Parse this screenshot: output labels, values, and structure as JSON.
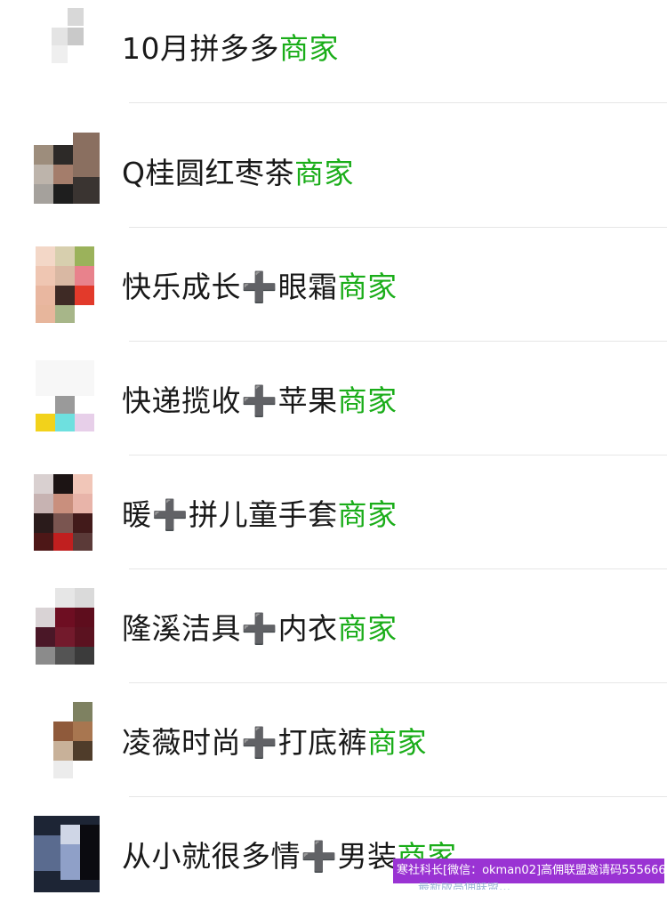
{
  "contacts": [
    {
      "name": "10月拼多多",
      "plus": "",
      "suffix": "",
      "tag": "商家"
    },
    {
      "name": "Q桂圆红枣茶",
      "plus": "",
      "suffix": "",
      "tag": "商家"
    },
    {
      "name": "快乐成长",
      "plus": "➕",
      "suffix": "眼霜",
      "tag": "商家"
    },
    {
      "name": "快递揽收",
      "plus": "➕",
      "suffix": "苹果",
      "tag": "商家"
    },
    {
      "name": "暖",
      "plus": "➕",
      "suffix": "拼儿童手套",
      "tag": "商家"
    },
    {
      "name": "隆溪洁具",
      "plus": "➕",
      "suffix": "内衣",
      "tag": "商家"
    },
    {
      "name": "凌薇时尚",
      "plus": "➕",
      "suffix": "打底裤",
      "tag": "商家"
    },
    {
      "name": "从小就很多情",
      "plus": "➕",
      "suffix": "男装",
      "tag": "商家"
    }
  ],
  "watermark": {
    "text": "寒社科长[微信：okman02]高佣联盟邀请码555666",
    "sub": "最新版高佣联盟…"
  },
  "colors": {
    "tag": "#1aad19",
    "watermark_bg": "#9a33d3"
  }
}
